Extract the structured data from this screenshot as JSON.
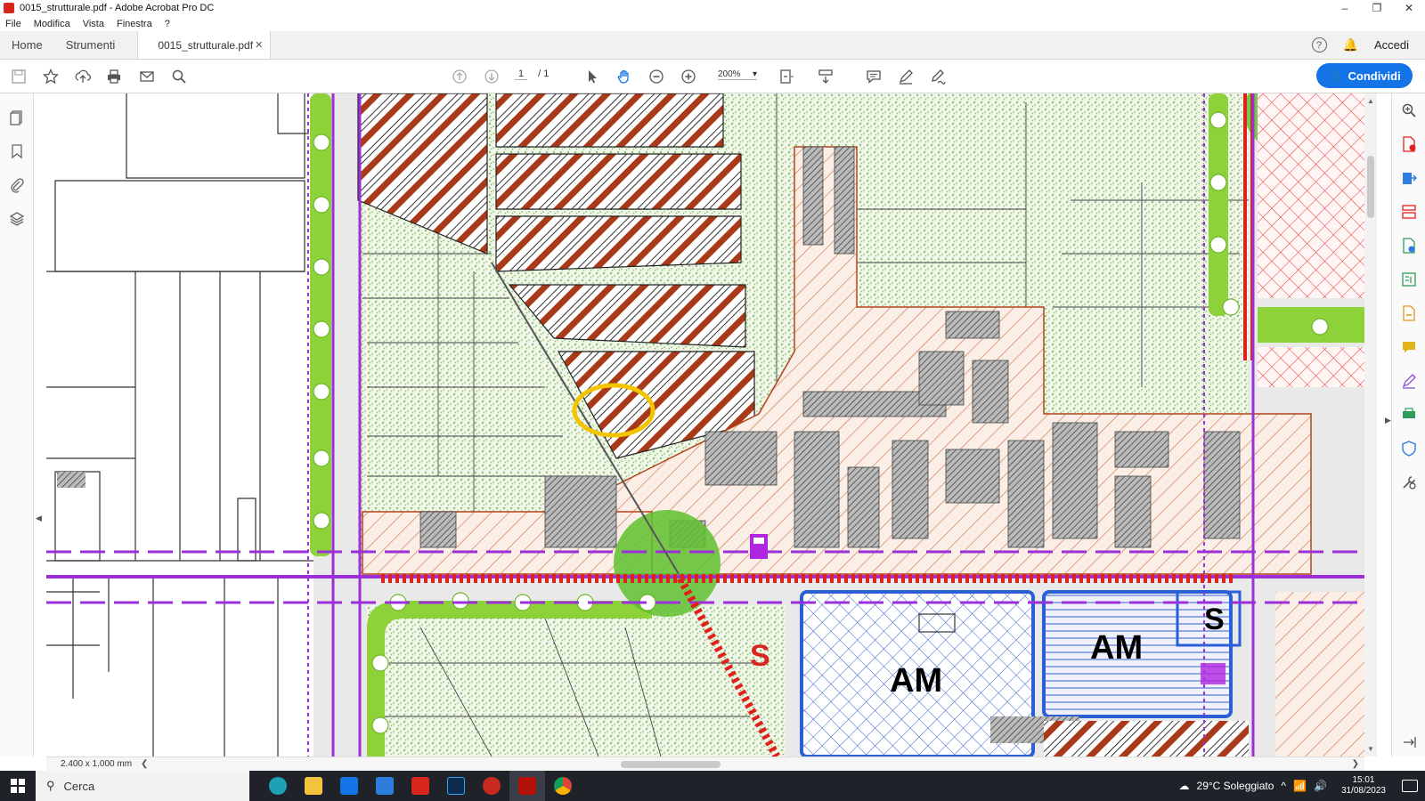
{
  "window": {
    "title": "0015_strutturale.pdf - Adobe Acrobat Pro DC"
  },
  "menu": [
    "File",
    "Modifica",
    "Vista",
    "Finestra",
    "?"
  ],
  "tabs": {
    "home": "Home",
    "tools": "Strumenti",
    "document": "0015_strutturale.pdf",
    "sign_in": "Accedi"
  },
  "toolbar": {
    "page_current": "1",
    "page_total": "/ 1",
    "zoom": "200%",
    "share_label": "Condividi"
  },
  "map": {
    "labels": {
      "am_left": "AM",
      "am_right": "AM",
      "s_red": "S",
      "s_black": "S"
    },
    "colors": {
      "purple_road": "#9b30d9",
      "red_rail": "#e0201b",
      "green_band": "#8ed23a",
      "blue_zone": "#2b5fd6",
      "brown_hatch": "#b5431c",
      "highlight_circle": "#f2c500"
    }
  },
  "status": {
    "page_size": "2.400 x 1.000 mm"
  },
  "taskbar": {
    "search_placeholder": "Cerca",
    "weather": "29°C  Soleggiato",
    "time": "15:01",
    "date": "31/08/2023"
  }
}
